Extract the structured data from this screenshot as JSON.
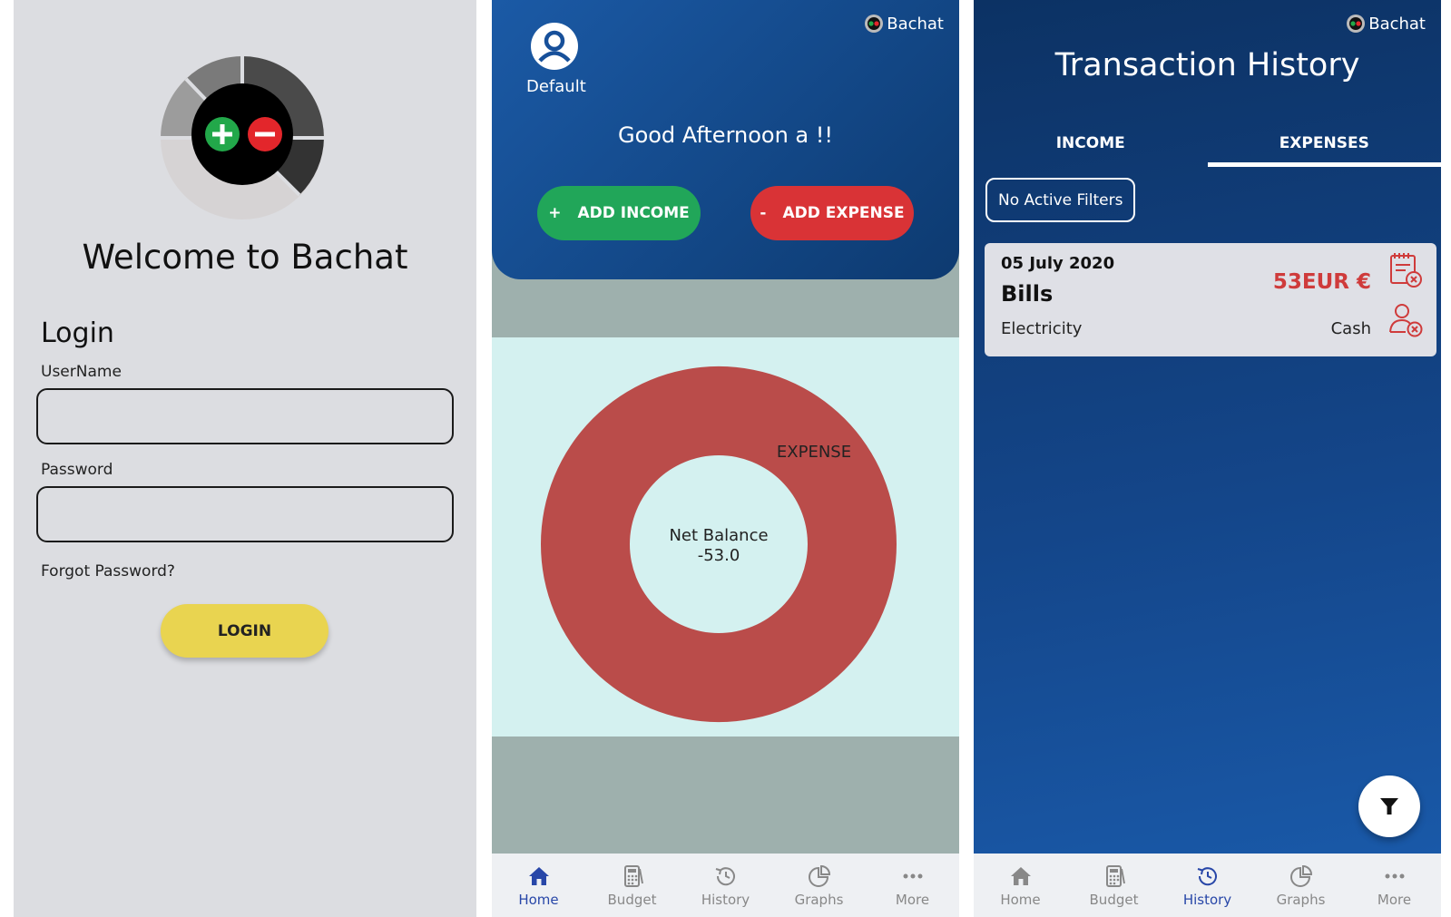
{
  "login_screen": {
    "welcome": "Welcome to Bachat",
    "title": "Login",
    "username_label": "UserName",
    "username_value": "",
    "password_label": "Password",
    "password_value": "",
    "forgot_password": "Forgot Password?",
    "login_button": "LOGIN"
  },
  "home_screen": {
    "brand": "Bachat",
    "profile_name": "Default",
    "greeting": "Good Afternoon a !!",
    "add_income": "ADD INCOME",
    "add_income_symbol": "+",
    "add_expense": "ADD EXPENSE",
    "add_expense_symbol": "-",
    "chart": {
      "slice_label": "EXPENSE",
      "center_title": "Net Balance",
      "center_value": "-53.0"
    }
  },
  "history_screen": {
    "brand": "Bachat",
    "title": "Transaction History",
    "tabs": [
      "INCOME",
      "EXPENSES"
    ],
    "active_tab": "EXPENSES",
    "filter_chip": "No Active Filters",
    "transactions": [
      {
        "date": "05 July 2020",
        "category": "Bills",
        "subcategory": "Electricity",
        "amount": "53EUR €",
        "mode": "Cash"
      }
    ]
  },
  "bottom_nav": {
    "items": [
      "Home",
      "Budget",
      "History",
      "Graphs",
      "More"
    ]
  },
  "chart_data": {
    "type": "pie",
    "categories": [
      "EXPENSE"
    ],
    "values": [
      53.0
    ],
    "title": "",
    "center_label": "Net Balance",
    "center_value": -53.0
  },
  "colors": {
    "income_green": "#21a659",
    "expense_red": "#d93336",
    "expense_slice": "#ba4c4a",
    "header_blue": "#1b5aa6",
    "nav_active": "#2847a8",
    "login_yellow": "#e9d450",
    "amount_red": "#cf3b3b"
  }
}
